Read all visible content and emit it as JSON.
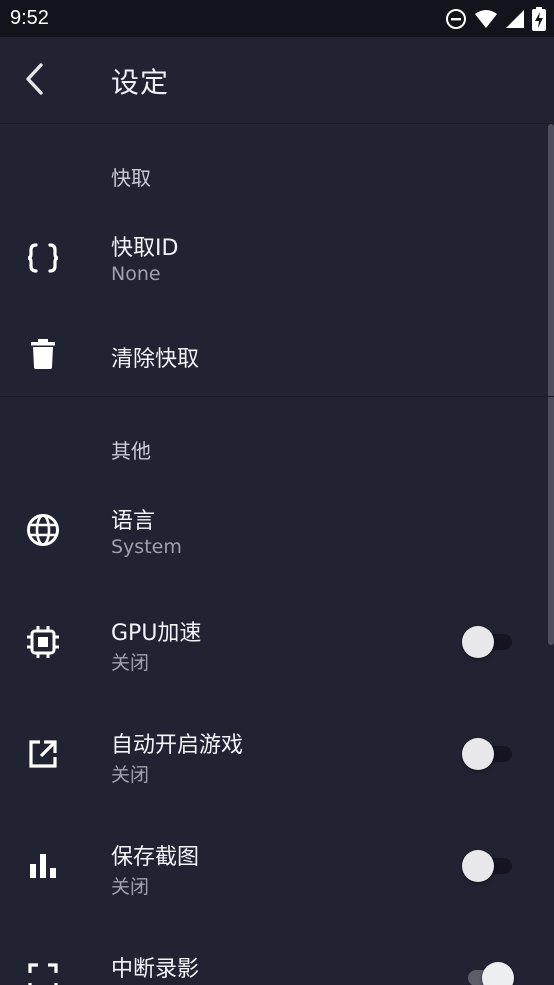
{
  "status_bar": {
    "time": "9:52"
  },
  "app_bar": {
    "title": "设定"
  },
  "sections": {
    "snapshot": {
      "header": "快取",
      "snapshot_id": {
        "title": "快取ID",
        "subtitle": "None"
      },
      "clear": {
        "title": "清除快取"
      }
    },
    "other": {
      "header": "其他",
      "language": {
        "title": "语言",
        "subtitle": "System"
      },
      "gpu": {
        "title": "GPU加速",
        "subtitle": "关闭",
        "enabled": false
      },
      "autostart": {
        "title": "自动开启游戏",
        "subtitle": "关闭",
        "enabled": false
      },
      "screenshot": {
        "title": "保存截图",
        "subtitle": "关闭",
        "enabled": false
      },
      "interrupt": {
        "title": "中断录影",
        "enabled": true
      }
    }
  },
  "colors": {
    "background": "#212332",
    "status_bar": "#12131b",
    "subtitle_text": "#9da1ad"
  }
}
